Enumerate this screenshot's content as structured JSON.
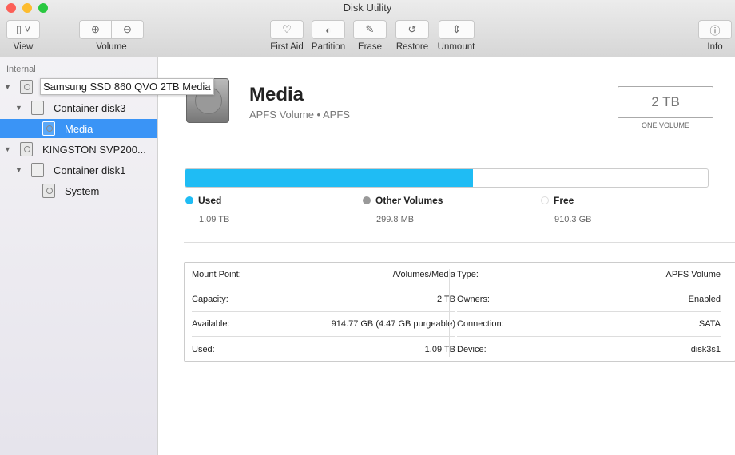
{
  "window": {
    "title": "Disk Utility"
  },
  "toolbar": {
    "view": "View",
    "volume": "Volume",
    "first_aid": "First Aid",
    "partition": "Partition",
    "erase": "Erase",
    "restore": "Restore",
    "unmount": "Unmount",
    "info": "Info"
  },
  "sidebar": {
    "section": "Internal",
    "items": [
      {
        "label": "Samsung SSD 860 QVO 2TB Media"
      },
      {
        "label": "Container disk3"
      },
      {
        "label": "Media"
      },
      {
        "label": "KINGSTON SVP200..."
      },
      {
        "label": "Container disk1"
      },
      {
        "label": "System"
      }
    ],
    "tooltip": "Samsung SSD 860 QVO 2TB Media"
  },
  "volume": {
    "name": "Media",
    "subtitle": "APFS Volume • APFS",
    "size": "2 TB",
    "size_label": "ONE VOLUME"
  },
  "usage": {
    "used_fraction": 0.55,
    "legend": [
      {
        "name": "Used",
        "value": "1.09 TB",
        "color": "#1fbcf4"
      },
      {
        "name": "Other Volumes",
        "value": "299.8 MB",
        "color": "#999999"
      },
      {
        "name": "Free",
        "value": "910.3 GB",
        "color": "#ffffff"
      }
    ]
  },
  "info": {
    "left": [
      {
        "k": "Mount Point:",
        "v": "/Volumes/Media"
      },
      {
        "k": "Capacity:",
        "v": "2 TB"
      },
      {
        "k": "Available:",
        "v": "914.77 GB (4.47 GB purgeable)"
      },
      {
        "k": "Used:",
        "v": "1.09 TB"
      }
    ],
    "right": [
      {
        "k": "Type:",
        "v": "APFS Volume"
      },
      {
        "k": "Owners:",
        "v": "Enabled"
      },
      {
        "k": "Connection:",
        "v": "SATA"
      },
      {
        "k": "Device:",
        "v": "disk3s1"
      }
    ]
  }
}
